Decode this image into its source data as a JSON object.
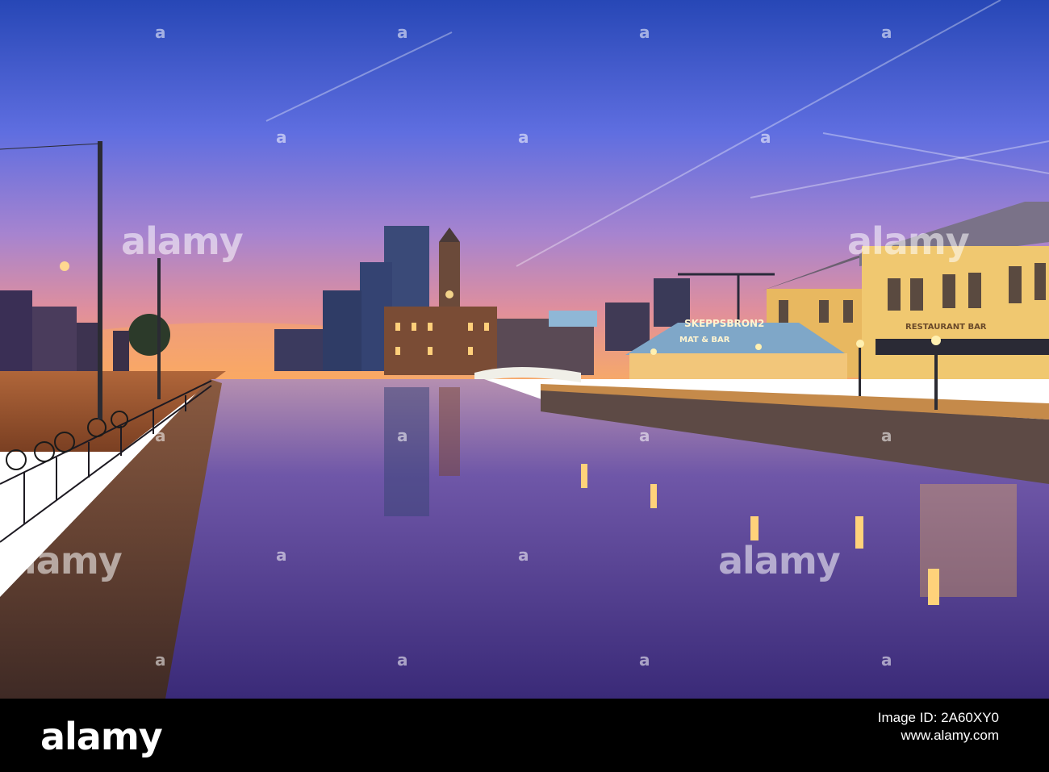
{
  "photo": {
    "sky_top": "#2a47b8",
    "sky_mid": "#8e78d6",
    "sky_low": "#f4a06a",
    "water": "#5b3e8f",
    "sign_name": "SKEPPSBRON2",
    "sign_sub": "MAT & BAR",
    "facade_sign": "RESTAURANT BAR"
  },
  "watermark": {
    "text": "alamy",
    "mark": "a"
  },
  "footer": {
    "logo": "alamy",
    "line1": "Image ID: 2A60XY0",
    "line2": "www.alamy.com",
    "bg": "#000000"
  }
}
